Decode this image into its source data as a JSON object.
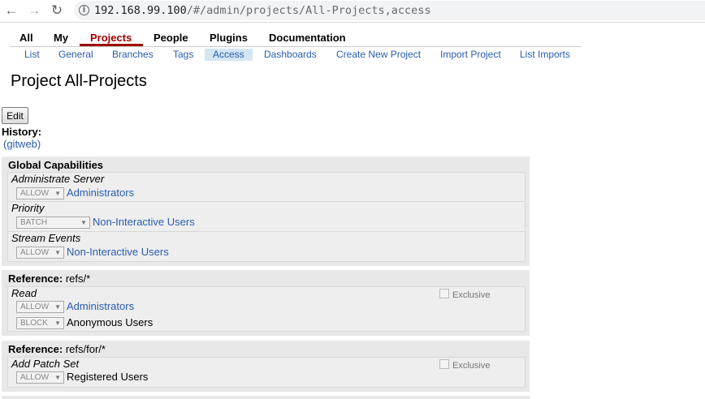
{
  "browser": {
    "url_host": "192.168.99.100",
    "url_path": "/#/admin/projects/All-Projects,access",
    "back_icon": "arrow-left-icon",
    "forward_icon": "arrow-right-icon",
    "reload_icon": "reload-icon",
    "info_icon": "info-icon"
  },
  "top_menu": {
    "items": [
      {
        "label": "All"
      },
      {
        "label": "My"
      },
      {
        "label": "Projects",
        "selected": true
      },
      {
        "label": "People"
      },
      {
        "label": "Plugins"
      },
      {
        "label": "Documentation"
      }
    ],
    "selected_color": "#a00000"
  },
  "sub_menu": {
    "items": [
      {
        "label": "List"
      },
      {
        "label": "General"
      },
      {
        "label": "Branches"
      },
      {
        "label": "Tags"
      },
      {
        "label": "Access",
        "selected": true
      },
      {
        "label": "Dashboards"
      },
      {
        "label": "Create New Project"
      },
      {
        "label": "Import Project"
      },
      {
        "label": "List Imports"
      }
    ],
    "link_color": "#2a5db0"
  },
  "page": {
    "title": "Project All-Projects",
    "edit_label": "Edit",
    "history_label": "History:",
    "gitweb_label": "(gitweb)"
  },
  "sections": {
    "global": {
      "title": "Global Capabilities",
      "permissions": [
        {
          "name": "Administrate Server",
          "rules": [
            {
              "action": "ALLOW",
              "group": "Administrators",
              "group_is_link": true
            }
          ]
        },
        {
          "name": "Priority",
          "rules": [
            {
              "action": "BATCH",
              "group": "Non-Interactive Users",
              "group_is_link": true
            }
          ]
        },
        {
          "name": "Stream Events",
          "rules": [
            {
              "action": "ALLOW",
              "group": "Non-Interactive Users",
              "group_is_link": true
            }
          ]
        }
      ]
    },
    "ref1": {
      "title_label": "Reference:",
      "title_value": "refs/*",
      "permissions": [
        {
          "name": "Read",
          "exclusive_label": "Exclusive",
          "rules": [
            {
              "action": "ALLOW",
              "group": "Administrators",
              "group_is_link": true
            },
            {
              "action": "BLOCK",
              "group": "Anonymous Users",
              "group_is_link": false
            }
          ]
        }
      ]
    },
    "ref2": {
      "title_label": "Reference:",
      "title_value": "refs/for/*",
      "permissions": [
        {
          "name": "Add Patch Set",
          "exclusive_label": "Exclusive",
          "rules": [
            {
              "action": "ALLOW",
              "group": "Registered Users",
              "group_is_link": false
            }
          ]
        }
      ]
    }
  }
}
